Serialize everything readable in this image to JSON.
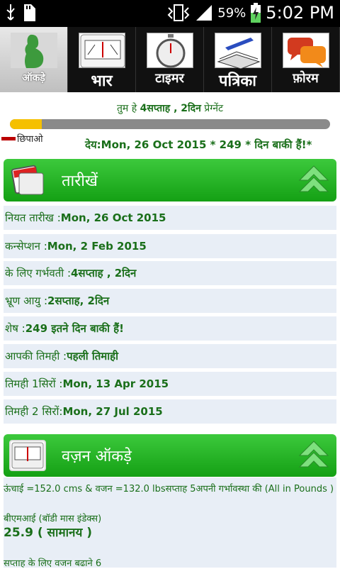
{
  "status_bar": {
    "battery_percent": "59%",
    "time": "5:02 PM"
  },
  "tabs": [
    {
      "label": "ऑकड़े",
      "icon": "pregnancy-icon"
    },
    {
      "label": "भार",
      "icon": "scale-icon"
    },
    {
      "label": "टाइमर",
      "icon": "stopwatch-icon"
    },
    {
      "label": "पत्रिका",
      "icon": "journal-icon"
    },
    {
      "label": "फ़ोरम",
      "icon": "chat-bubbles-icon"
    }
  ],
  "pregnancy_status": {
    "prefix": "तुम हे ",
    "value": "4सप्ताह , 2दिन",
    "suffix": " प्रेग्नेंट"
  },
  "progress": {
    "fraction": 0.1
  },
  "hide_label": "छिपाओ",
  "due_line": "देय:Mon, 26 Oct 2015 * 249 * दिन बाकी हैं!*",
  "dates_section": {
    "title": "तारीखें",
    "rows": [
      {
        "label": "नियत तारीख :",
        "value": "Mon, 26 Oct 2015"
      },
      {
        "label": "कन्सेप्शन :",
        "value": "Mon, 2 Feb 2015"
      },
      {
        "label": "के लिए गर्भवती :",
        "value": "4सप्ताह , 2दिन"
      },
      {
        "label": "भ्रूण आयु :",
        "value": "2सप्ताह, 2दिन"
      },
      {
        "label": "शेष :",
        "value": "249 इतने दिन बाकी हैं!"
      },
      {
        "label": "आपकी तिमही :",
        "value": "पहली तिमाही"
      },
      {
        "label": "तिमही 1सिरों :",
        "value": "Mon, 13 Apr 2015"
      },
      {
        "label": "तिमही 2 सिरों:",
        "value": "Mon, 27 Jul 2015"
      }
    ]
  },
  "weight_section": {
    "title": "वज़न ऑकड़े",
    "summary": "ऊंचाई =152.0 cms & वजन =132.0 lbsसप्ताह 5अपनी गर्भावस्था की (All in Pounds )",
    "bmi_label": "बीएमआई (बॉडी मास इंडेक्स)",
    "bmi_value": "25.9 ( सामानय )",
    "gain_line": "सप्ताह के लिए वजन बढाने 6"
  },
  "colors": {
    "header_green": "#14a014",
    "text_green": "#1a6f1a",
    "progress_fill": "#f5c000",
    "row_bg": "#e8eef6"
  }
}
